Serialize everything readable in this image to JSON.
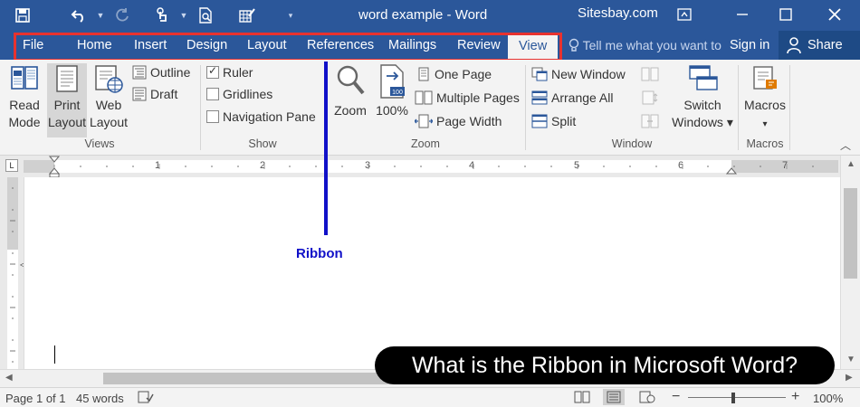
{
  "window": {
    "title": "word example - Word",
    "site": "Sitesbay.com"
  },
  "tabs": [
    {
      "label": "File"
    },
    {
      "label": "Home"
    },
    {
      "label": "Insert"
    },
    {
      "label": "Design"
    },
    {
      "label": "Layout"
    },
    {
      "label": "References"
    },
    {
      "label": "Mailings"
    },
    {
      "label": "Review"
    },
    {
      "label": "View",
      "active": true
    }
  ],
  "tell_me": "Tell me what you want to do",
  "sign_in": "Sign in",
  "share": "Share",
  "ribbon": {
    "views": {
      "label": "Views",
      "read_mode": [
        "Read",
        "Mode"
      ],
      "print_layout": [
        "Print",
        "Layout"
      ],
      "web_layout": [
        "Web",
        "Layout"
      ],
      "outline": "Outline",
      "draft": "Draft"
    },
    "show": {
      "label": "Show",
      "ruler": {
        "label": "Ruler",
        "checked": true
      },
      "gridlines": {
        "label": "Gridlines",
        "checked": false
      },
      "navigation_pane": {
        "label": "Navigation Pane",
        "checked": false
      }
    },
    "zoom": {
      "label": "Zoom",
      "zoom": "Zoom",
      "hundred": "100%",
      "one_page": "One Page",
      "multiple_pages": "Multiple Pages",
      "page_width": "Page Width"
    },
    "window": {
      "label": "Window",
      "new_window": "New Window",
      "arrange_all": "Arrange All",
      "split": "Split",
      "switch_windows": [
        "Switch",
        "Windows ▾"
      ]
    },
    "macros": {
      "label": "Macros",
      "macros": "Macros"
    }
  },
  "ruler_numbers": [
    "1",
    "2",
    "3",
    "4",
    "5",
    "6",
    "7"
  ],
  "annotation": {
    "label": "Ribbon",
    "banner": "What is the Ribbon in Microsoft Word?"
  },
  "status": {
    "page": "Page 1 of 1",
    "words": "45 words",
    "zoom": "100%"
  },
  "colors": {
    "brand": "#2b579a",
    "highlight": "#e8322f",
    "annotation": "#1010c8"
  }
}
